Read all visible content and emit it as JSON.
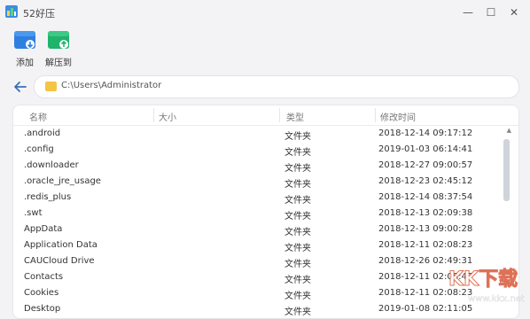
{
  "window": {
    "title": "52好压",
    "controls": {
      "minimize": "—",
      "maximize": "☐",
      "close": "✕"
    }
  },
  "toolbar": {
    "items": [
      {
        "label": "添加",
        "icon": "add-archive-icon",
        "color": "#2f7fe0"
      },
      {
        "label": "解压到",
        "icon": "extract-to-icon",
        "color": "#1fb36b"
      }
    ]
  },
  "address": {
    "path": "C:\\Users\\Administrator"
  },
  "table": {
    "columns": [
      "名称",
      "大小",
      "类型",
      "修改时间"
    ],
    "rows": [
      {
        "name": ".android",
        "size": "",
        "type": "文件夹",
        "modified": "2018-12-14 09:17:12"
      },
      {
        "name": ".config",
        "size": "",
        "type": "文件夹",
        "modified": "2019-01-03 06:14:41"
      },
      {
        "name": ".downloader",
        "size": "",
        "type": "文件夹",
        "modified": "2018-12-27 09:00:57"
      },
      {
        "name": ".oracle_jre_usage",
        "size": "",
        "type": "文件夹",
        "modified": "2018-12-23 02:45:12"
      },
      {
        "name": ".redis_plus",
        "size": "",
        "type": "文件夹",
        "modified": "2018-12-14 08:37:54"
      },
      {
        "name": ".swt",
        "size": "",
        "type": "文件夹",
        "modified": "2018-12-13 02:09:38"
      },
      {
        "name": "AppData",
        "size": "",
        "type": "文件夹",
        "modified": "2018-12-13 09:00:28"
      },
      {
        "name": "Application Data",
        "size": "",
        "type": "文件夹",
        "modified": "2018-12-11 02:08:23"
      },
      {
        "name": "CAUCloud Drive",
        "size": "",
        "type": "文件夹",
        "modified": "2018-12-26 02:49:31"
      },
      {
        "name": "Contacts",
        "size": "",
        "type": "文件夹",
        "modified": "2018-12-11 02:08:47"
      },
      {
        "name": "Cookies",
        "size": "",
        "type": "文件夹",
        "modified": "2018-12-11 02:08:23"
      },
      {
        "name": "Desktop",
        "size": "",
        "type": "文件夹",
        "modified": "2019-01-08 02:11:05"
      }
    ]
  },
  "watermark": {
    "text": "KK下载",
    "url": "www.kkx.net"
  }
}
